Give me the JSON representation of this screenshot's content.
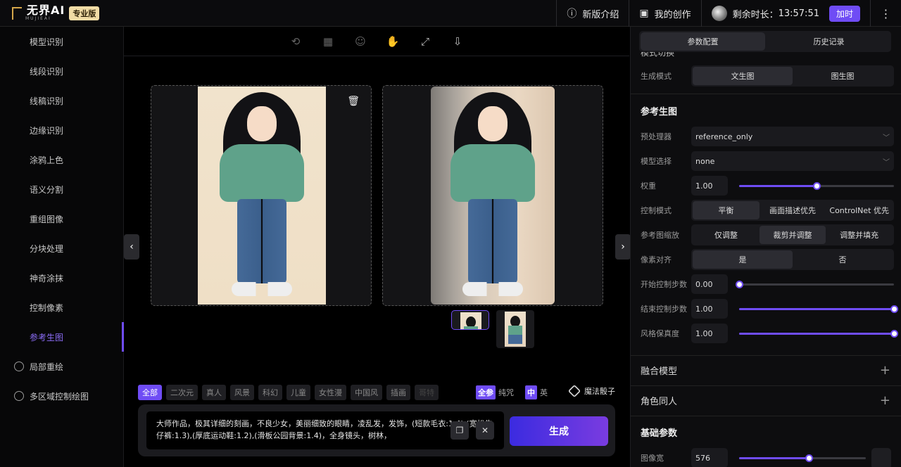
{
  "header": {
    "logo_text": "无界AI",
    "logo_sub": "MUJIEAI",
    "edition_badge": "专业版",
    "release_notes": "新版介绍",
    "my_creations": "我的创作",
    "remaining_time_label": "剩余时长：",
    "remaining_time_value": "13:57:51",
    "add_time_button": "加时",
    "more_icon": "more-vertical-icon"
  },
  "sidebar": {
    "items": [
      {
        "label": "模型识别"
      },
      {
        "label": "线段识别"
      },
      {
        "label": "线稿识别"
      },
      {
        "label": "边缘识别"
      },
      {
        "label": "涂鸦上色"
      },
      {
        "label": "语义分割"
      },
      {
        "label": "重组图像"
      },
      {
        "label": "分块处理"
      },
      {
        "label": "神奇涂抹"
      },
      {
        "label": "控制像素"
      },
      {
        "label": "参考生图",
        "active": true
      }
    ],
    "top_items": [
      {
        "label": "局部重绘"
      },
      {
        "label": "多区域控制绘图"
      }
    ]
  },
  "toolbar": {
    "icons": [
      "reset-icon",
      "compare-icon",
      "face-icon",
      "hand-icon",
      "fullscreen-icon",
      "download-icon"
    ]
  },
  "prompt": {
    "tags": [
      "全部",
      "二次元",
      "真人",
      "风景",
      "科幻",
      "儿童",
      "女性漫",
      "中国风",
      "插画",
      "哥特"
    ],
    "toggle_full": "全参",
    "toggle_pure": "纯咒",
    "toggle_cn": "中",
    "toggle_en": "英",
    "dice_label": "魔法骰子",
    "text": "大师作品，极其详细的刻画，不良少女，美丽细致的眼睛，凌乱发，发饰，(短款毛衣:1.4),(宽松牛仔裤:1.3),(厚底运动鞋:1.2),(滑板公园背景:1.4)，全身镜头，树林，",
    "generate_button": "生成"
  },
  "right_panel": {
    "tabs": [
      "参数配置",
      "历史记录"
    ],
    "cut_heading": "模式切换",
    "gen_mode_label": "生成模式",
    "gen_mode_options": [
      "文生图",
      "图生图"
    ],
    "section_ref": "参考生图",
    "preprocessor_label": "预处理器",
    "preprocessor_value": "reference_only",
    "model_label": "模型选择",
    "model_value": "none",
    "weight_label": "权重",
    "weight_value": "1.00",
    "weight_fraction": 0.5,
    "control_mode_label": "控制模式",
    "control_mode_options": [
      "平衡",
      "画面描述优先",
      "ControlNet 优先"
    ],
    "resize_label": "参考图缩放",
    "resize_options": [
      "仅调整",
      "裁剪并调整",
      "调整并填充"
    ],
    "pixel_align_label": "像素对齐",
    "pixel_align_options": [
      "是",
      "否"
    ],
    "start_step_label": "开始控制步数",
    "start_step_value": "0.00",
    "start_step_fraction": 0,
    "end_step_label": "结束控制步数",
    "end_step_value": "1.00",
    "end_step_fraction": 1,
    "style_label": "风格保真度",
    "style_value": "1.00",
    "style_fraction": 1,
    "fold_merge": "融合模型",
    "fold_role": "角色同人",
    "section_basic": "基础参数",
    "width_label": "图像宽",
    "width_value": "576",
    "width_fraction": 0.55
  }
}
